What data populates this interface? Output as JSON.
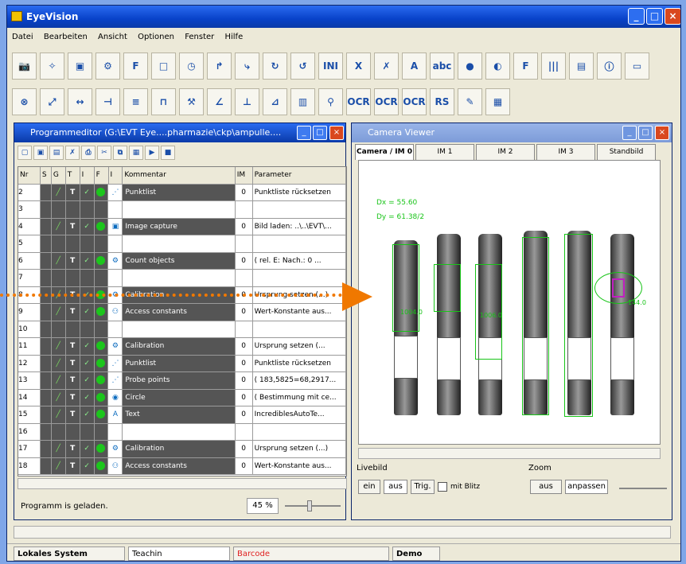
{
  "app": {
    "title": "EyeVision"
  },
  "menu": [
    "Datei",
    "Bearbeiten",
    "Ansicht",
    "Optionen",
    "Fenster",
    "Hilfe"
  ],
  "toolbar1": [
    "camera-icon",
    "magic-wand-icon",
    "image-edit-icon",
    "pattern-icon",
    "fit-icon",
    "rectangle-icon",
    "timer-icon",
    "step-in-icon",
    "branch-icon",
    "loop-icon",
    "counter-icon",
    "ini-icon",
    "formula-icon",
    "delete-icon",
    "font-icon",
    "abc-icon",
    "color-dots-icon",
    "palette-icon",
    "filter-icon",
    "barcode-icon",
    "window-icon",
    "info-icon",
    "camera-green-icon"
  ],
  "toolbar2": [
    "circle-cross-icon",
    "diagonal-icon",
    "horizontal-measure-icon",
    "center-icon",
    "align-icon",
    "bracket-icon",
    "tool-icon",
    "angle-icon",
    "chart-icon",
    "skew-icon",
    "bars-icon",
    "plug-icon",
    "ocr-ctrl-icon",
    "ocr-icon",
    "ocr-check-icon",
    "rs232-icon",
    "edit-icon",
    "texture-icon"
  ],
  "program_editor": {
    "title": "Programmeditor (G:\\EVT Eye....pharmazie\\ckp\\ampulle....",
    "headers": [
      "Nr",
      "S",
      "G",
      "T",
      "I",
      "F",
      "I",
      "Kommentar",
      "IM",
      "Parameter"
    ],
    "rows": [
      {
        "nr": "2",
        "comment": "Punktlist",
        "param": "Punktliste rücksetzen",
        "im": "0"
      },
      {
        "nr": "3",
        "comment": "",
        "param": "",
        "im": ""
      },
      {
        "nr": "4",
        "comment": "Image capture",
        "param": "Bild laden: ..\\..\\EVT\\...",
        "im": "0"
      },
      {
        "nr": "5",
        "comment": "",
        "param": "",
        "im": ""
      },
      {
        "nr": "6",
        "comment": "Count objects",
        "param": "( rel. E: Nach.: 0 ...",
        "im": "0"
      },
      {
        "nr": "7",
        "comment": "",
        "param": "",
        "im": ""
      },
      {
        "nr": "8",
        "comment": "Calibration",
        "param": "Ursprung setzen (...)",
        "im": "0"
      },
      {
        "nr": "9",
        "comment": "Access constants",
        "param": "Wert-Konstante aus...",
        "im": "0"
      },
      {
        "nr": "10",
        "comment": "",
        "param": "",
        "im": ""
      },
      {
        "nr": "11",
        "comment": "Calibration",
        "param": "Ursprung setzen (...",
        "im": "0"
      },
      {
        "nr": "12",
        "comment": "Punktlist",
        "param": "Punktliste rücksetzen",
        "im": "0"
      },
      {
        "nr": "13",
        "comment": "Probe points",
        "param": "( 183,5825=68,2917...",
        "im": "0"
      },
      {
        "nr": "14",
        "comment": "Circle",
        "param": "( Bestimmung mit ce...",
        "im": "0"
      },
      {
        "nr": "15",
        "comment": "Text",
        "param": "IncrediblesAutoTe...",
        "im": "0"
      },
      {
        "nr": "16",
        "comment": "",
        "param": "",
        "im": ""
      },
      {
        "nr": "17",
        "comment": "Calibration",
        "param": "Ursprung setzen (...)",
        "im": "0"
      },
      {
        "nr": "18",
        "comment": "Access constants",
        "param": "Wert-Konstante aus...",
        "im": "0"
      }
    ],
    "status": "Programm is geladen.",
    "zoom": "45 %"
  },
  "camera_viewer": {
    "title": "Camera Viewer",
    "tabs": [
      "Camera / IM 0",
      "IM 1",
      "IM 2",
      "IM 3",
      "Standbild"
    ],
    "overlay": [
      "Dx = 55.60",
      "Dy = 61.38/2"
    ],
    "measure": [
      "1004.0",
      "144.0",
      "1006.0"
    ],
    "livebild_label": "Livebild",
    "livebild_buttons": [
      "ein",
      "aus",
      "Trig."
    ],
    "mit_blitz": "mit Blitz",
    "zoom_label": "Zoom",
    "zoom_buttons": [
      "aus",
      "anpassen"
    ]
  },
  "status_bar": {
    "system": "Lokales System",
    "tech": "Teachin",
    "barcode": "Barcode",
    "demo": "Demo"
  },
  "colors": {
    "accent": "#0842c9",
    "overlay_green": "#18c418",
    "arrow": "#f07800"
  }
}
